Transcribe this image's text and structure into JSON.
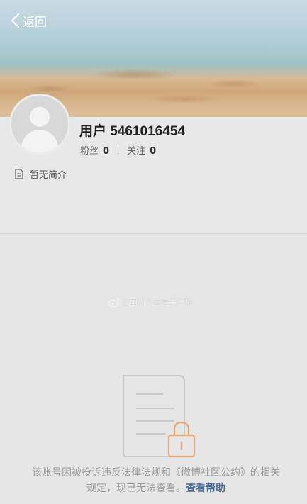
{
  "nav": {
    "back_label": "返回"
  },
  "profile": {
    "username": "用户 5461016454",
    "fans_label": "粉丝",
    "fans_count": "0",
    "follow_label": "关注",
    "follow_count": "0",
    "bio": "暂无简介"
  },
  "watermark": "@国内外自言关注帮",
  "notice": {
    "message": "该账号因被投诉违反法律法规和《微博社区公约》的相关规定，现已无法查看。",
    "help_link": "查看帮助"
  },
  "colors": {
    "background": "#e6e6e6",
    "link": "#4a6e97",
    "lock": "#e8a873"
  },
  "icons": [
    "chevron-left-icon",
    "document-icon",
    "weibo-icon",
    "document-lock-icon"
  ]
}
